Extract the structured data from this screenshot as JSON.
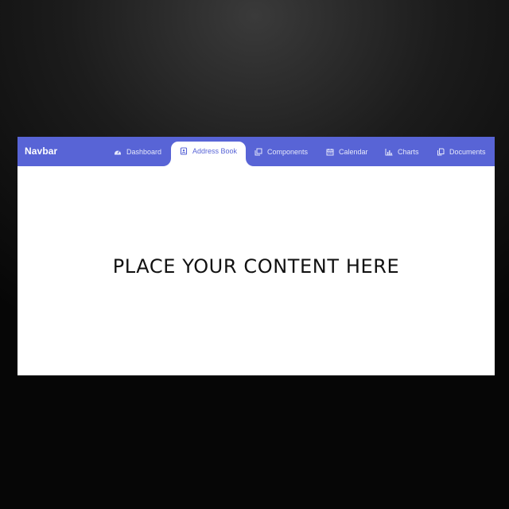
{
  "navbar": {
    "brand": "Navbar",
    "items": [
      {
        "label": "Dashboard",
        "icon": "dashboard-icon",
        "active": false
      },
      {
        "label": "Address Book",
        "icon": "address-book-icon",
        "active": true
      },
      {
        "label": "Components",
        "icon": "components-icon",
        "active": false
      },
      {
        "label": "Calendar",
        "icon": "calendar-icon",
        "active": false
      },
      {
        "label": "Charts",
        "icon": "bar-chart-icon",
        "active": false
      },
      {
        "label": "Documents",
        "icon": "documents-icon",
        "active": false
      }
    ]
  },
  "main": {
    "placeholder_text": "PLACE YOUR CONTENT HERE"
  },
  "colors": {
    "navbar_bg": "#5864d6",
    "active_text": "#5864d6",
    "inactive_text": "#e6e8fb",
    "content_bg": "#ffffff"
  }
}
